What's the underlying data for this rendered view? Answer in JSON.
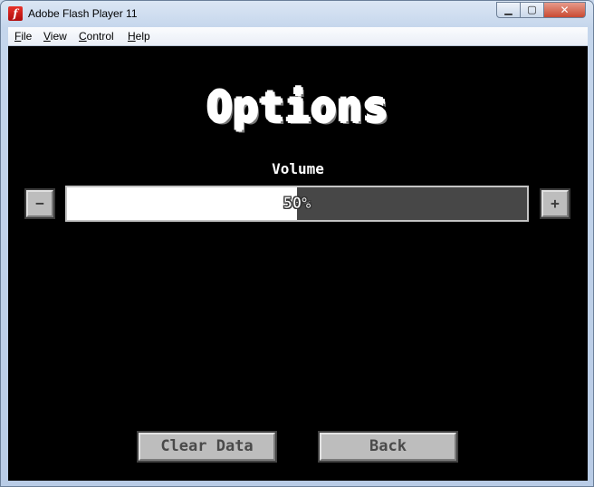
{
  "window": {
    "title": "Adobe Flash Player 11",
    "app_icon": "flash-icon",
    "controls": {
      "minimize": "minimize-icon",
      "maximize": "maximize-icon",
      "close": "close-icon"
    }
  },
  "menubar": {
    "items": [
      {
        "accel": "F",
        "rest": "ile"
      },
      {
        "accel": "V",
        "rest": "iew"
      },
      {
        "accel": "C",
        "rest": "ontrol"
      },
      {
        "accel": "H",
        "rest": "elp"
      }
    ]
  },
  "options": {
    "title": "Options",
    "volume": {
      "label": "Volume",
      "value_text": "50%",
      "level": 0.5,
      "decrease_label": "−",
      "increase_label": "+"
    }
  },
  "buttons": {
    "clear_data": "Clear Data",
    "back": "Back"
  },
  "colors": {
    "stage_bg": "#000000",
    "button_face": "#bdbdbd",
    "bar_fill": "#ffffff",
    "bar_track": "#474747"
  }
}
